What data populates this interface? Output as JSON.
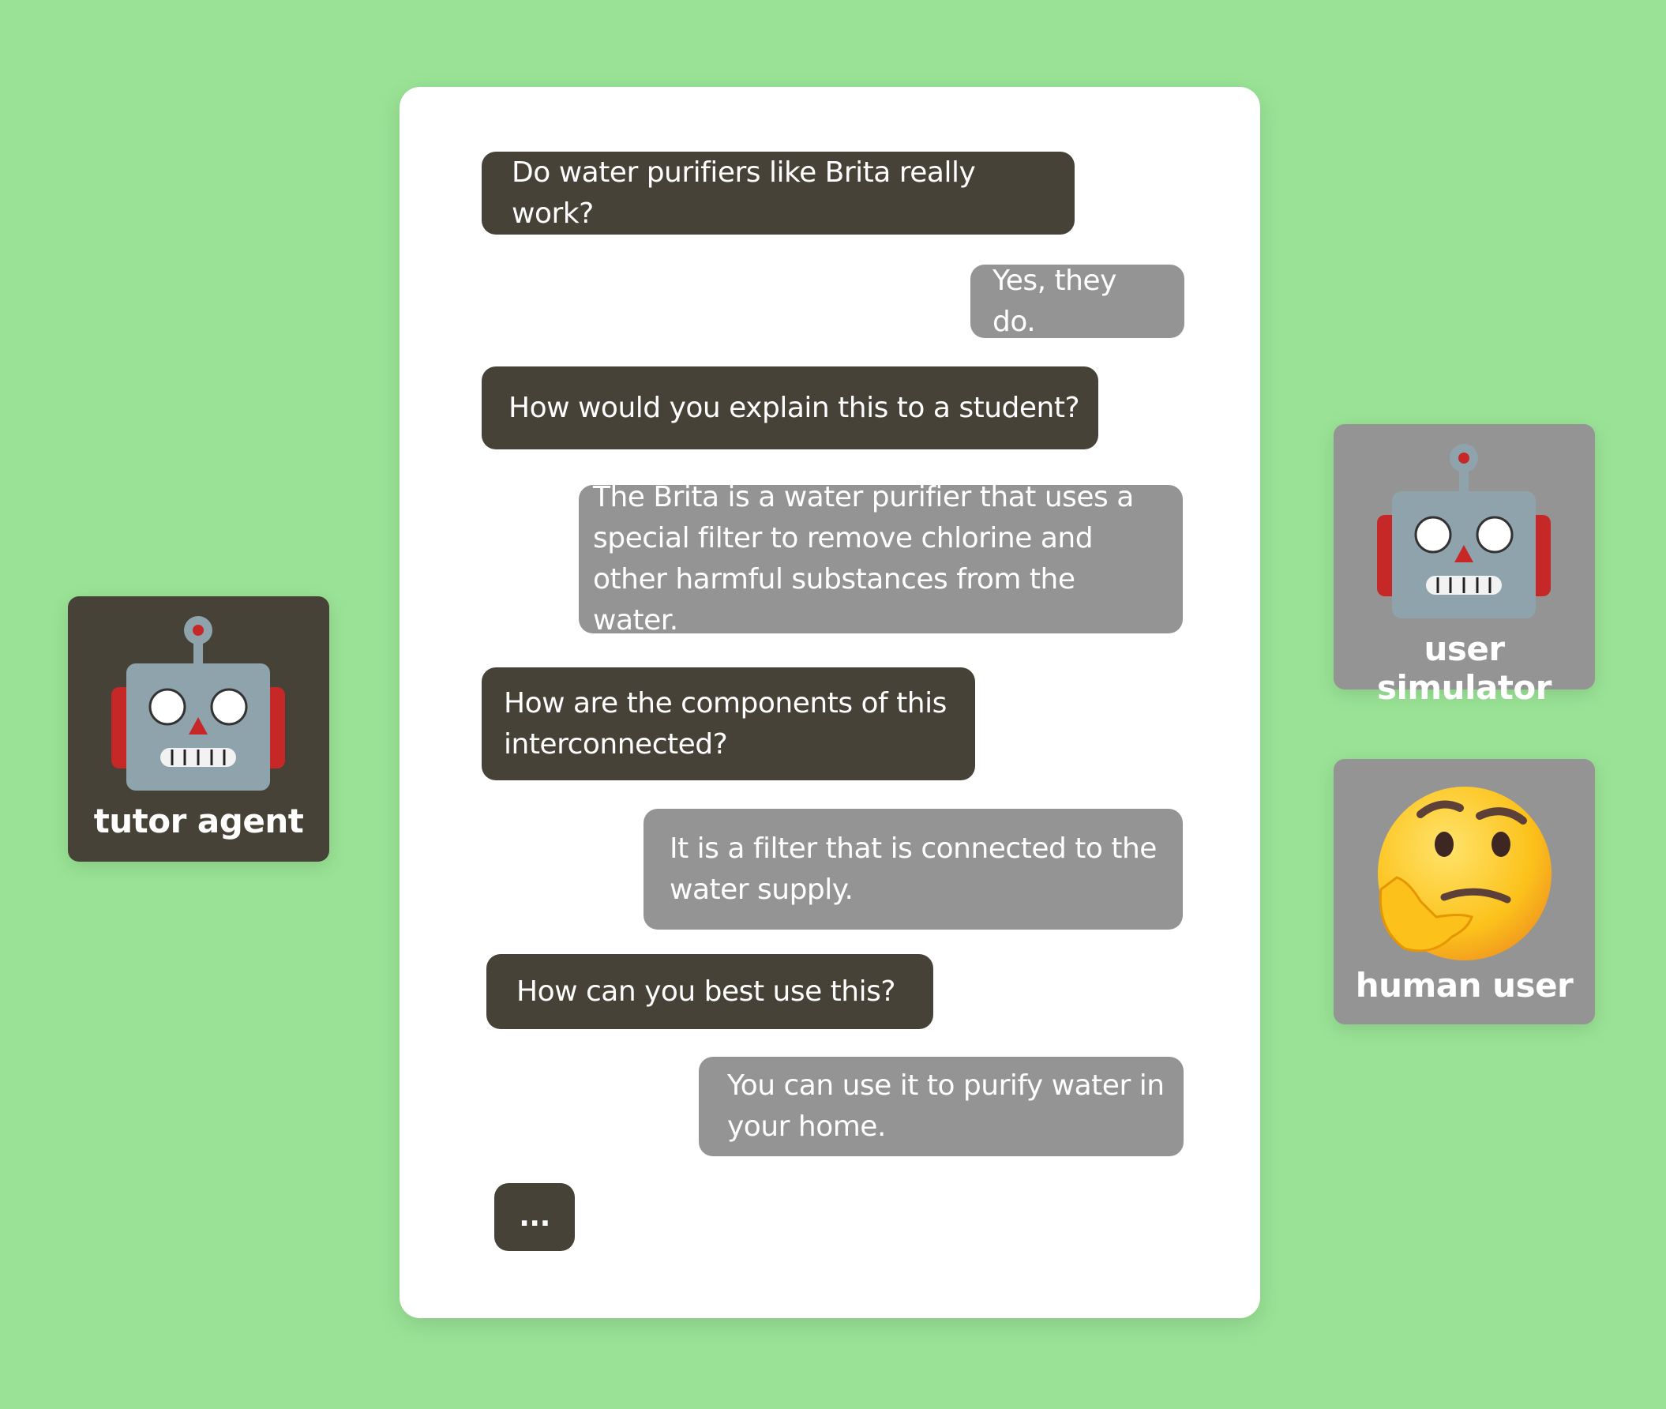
{
  "colors": {
    "background": "#9ae396",
    "agent_bubble": "#474237",
    "user_bubble": "#949494",
    "card": "#ffffff"
  },
  "conversation": [
    {
      "role": "tutor",
      "text": "Do water purifiers like Brita really work?"
    },
    {
      "role": "user",
      "text": "Yes, they do."
    },
    {
      "role": "tutor",
      "text": "How would you explain this to a student?"
    },
    {
      "role": "user",
      "text": "The Brita is a water purifier that uses a special filter to remove chlorine and other harmful substances from the water."
    },
    {
      "role": "tutor",
      "text": "How are the components of this interconnected?"
    },
    {
      "role": "user",
      "text": "It is a filter that is connected to the water supply."
    },
    {
      "role": "tutor",
      "text": "How can you best use this?"
    },
    {
      "role": "user",
      "text": "You can use it to purify water in your home."
    },
    {
      "role": "tutor",
      "text": "..."
    }
  ],
  "agents": {
    "tutor": {
      "label": "tutor agent",
      "icon": "robot-icon"
    },
    "simulator": {
      "label": "user simulator",
      "icon": "robot-icon"
    },
    "human": {
      "label": "human user",
      "icon": "thinking-face-icon"
    }
  }
}
